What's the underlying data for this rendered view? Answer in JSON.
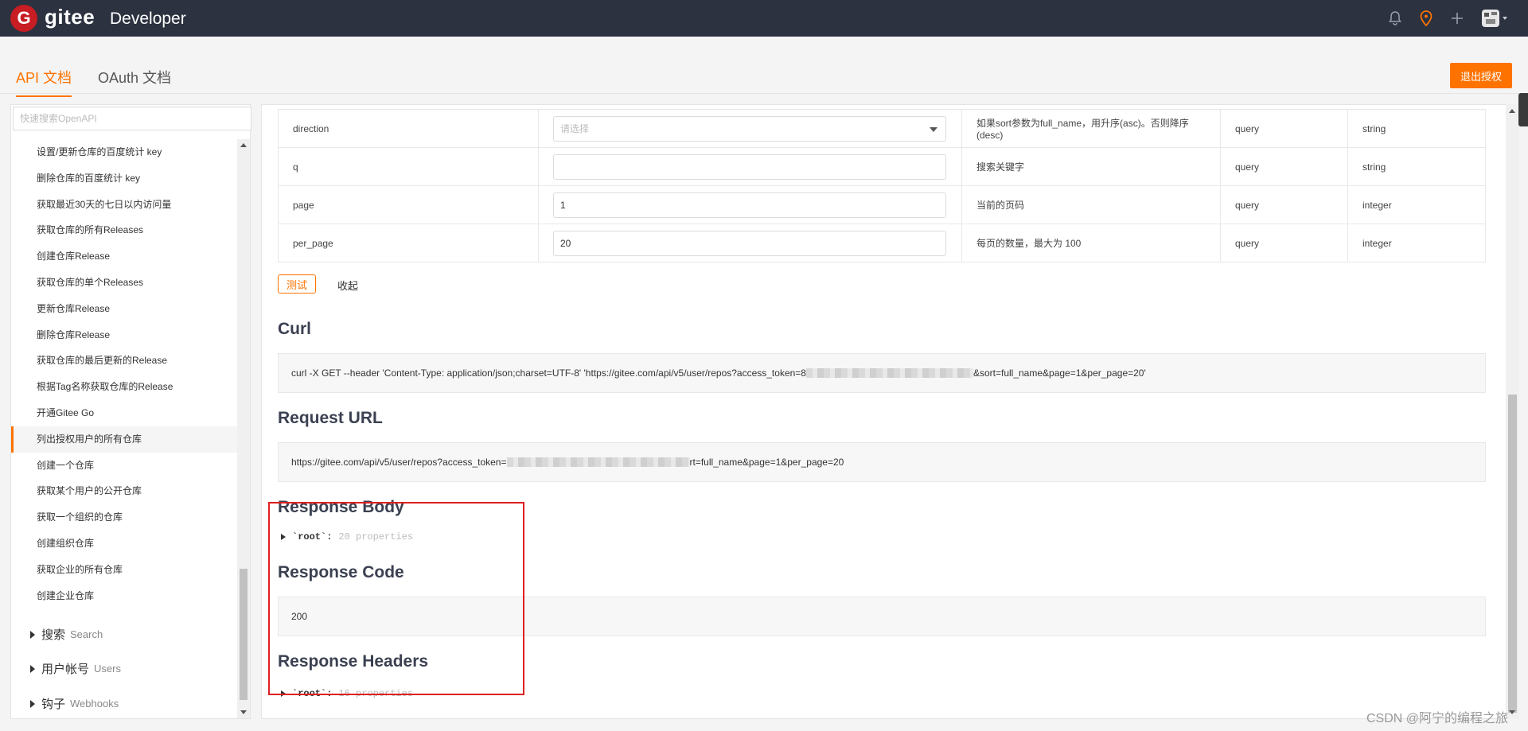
{
  "header": {
    "logo_letter": "G",
    "brand": "gitee",
    "subtitle": "Developer",
    "icons": [
      "bell-icon",
      "location-pin-icon",
      "plus-icon",
      "avatar"
    ]
  },
  "tabs": [
    {
      "label": "API 文档",
      "active": true
    },
    {
      "label": "OAuth 文档",
      "active": false
    }
  ],
  "logout_label": "退出授权",
  "sidebar": {
    "search_placeholder": "快速搜索OpenAPI",
    "items": [
      "设置/更新仓库的百度统计 key",
      "删除仓库的百度统计 key",
      "获取最近30天的七日以内访问量",
      "获取仓库的所有Releases",
      "创建仓库Release",
      "获取仓库的单个Releases",
      "更新仓库Release",
      "删除仓库Release",
      "获取仓库的最后更新的Release",
      "根据Tag名称获取仓库的Release",
      "开通Gitee Go",
      "列出授权用户的所有仓库",
      "创建一个仓库",
      "获取某个用户的公开仓库",
      "获取一个组织的仓库",
      "创建组织仓库",
      "获取企业的所有仓库",
      "创建企业仓库"
    ],
    "active_index": 11,
    "groups": [
      {
        "cn": "搜索",
        "en": "Search"
      },
      {
        "cn": "用户帐号",
        "en": "Users"
      },
      {
        "cn": "钩子",
        "en": "Webhooks"
      }
    ]
  },
  "params": [
    {
      "name": "direction",
      "value": "请选择",
      "is_select": true,
      "desc": "如果sort参数为full_name，用升序(asc)。否则降序(desc)",
      "in": "query",
      "type": "string"
    },
    {
      "name": "q",
      "value": "",
      "is_select": false,
      "desc": "搜索关键字",
      "in": "query",
      "type": "string"
    },
    {
      "name": "page",
      "value": "1",
      "is_select": false,
      "desc": "当前的页码",
      "in": "query",
      "type": "integer"
    },
    {
      "name": "per_page",
      "value": "20",
      "is_select": false,
      "desc": "每页的数量，最大为 100",
      "in": "query",
      "type": "integer"
    }
  ],
  "actions": {
    "test": "测试",
    "collapse": "收起"
  },
  "curl": {
    "title": "Curl",
    "prefix": "curl -X GET --header 'Content-Type: application/json;charset=UTF-8' 'https://gitee.com/api/v5/user/repos?access_token=8",
    "suffix": "&sort=full_name&page=1&per_page=20'"
  },
  "request_url": {
    "title": "Request URL",
    "prefix": "https://gitee.com/api/v5/user/repos?access_token=",
    "suffix": "rt=full_name&page=1&per_page=20"
  },
  "response_body": {
    "title": "Response Body",
    "key": "`root`:",
    "props": "20 properties"
  },
  "response_code": {
    "title": "Response Code",
    "value": "200"
  },
  "response_headers": {
    "title": "Response Headers",
    "key": "`root`:",
    "props": "16 properties"
  },
  "watermark": "CSDN @阿宁的编程之旅",
  "colors": {
    "accent": "#fe7300",
    "topbar": "#2c3240",
    "highlight": "#e02020"
  }
}
